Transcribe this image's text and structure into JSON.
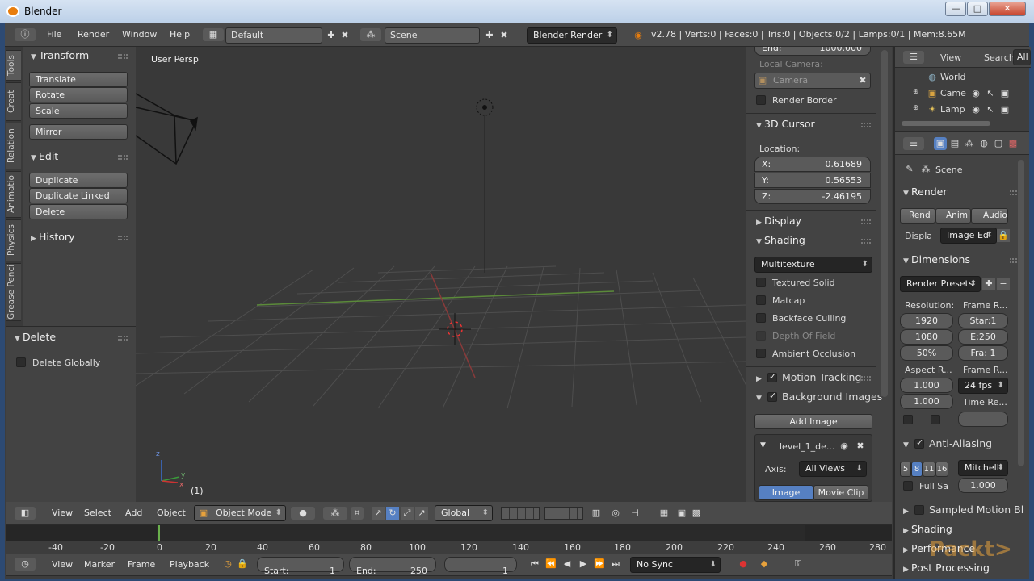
{
  "window": {
    "title": "Blender",
    "min": "—",
    "max": "□",
    "close": "✕"
  },
  "topbar": {
    "menu": [
      "File",
      "Render",
      "Window",
      "Help"
    ],
    "layout": "Default",
    "scene": "Scene",
    "engine": "Blender Render",
    "stats": "v2.78 | Verts:0 | Faces:0 | Tris:0 | Objects:0/2 | Lamps:0/1 | Mem:8.65M"
  },
  "toolshelf": {
    "tabs": [
      "Tools",
      "Creat",
      "Relation",
      "Animatio",
      "Physics",
      "Grease Penci"
    ],
    "transform": {
      "title": "Transform",
      "buttons": [
        "Translate",
        "Rotate",
        "Scale"
      ],
      "mirror": "Mirror"
    },
    "edit": {
      "title": "Edit",
      "buttons": [
        "Duplicate",
        "Duplicate Linked",
        "Delete"
      ]
    },
    "history": {
      "title": "History"
    },
    "operator": {
      "title": "Delete",
      "checkbox": "Delete Globally"
    }
  },
  "viewport": {
    "label": "User Persp",
    "frame": "(1)",
    "axes": {
      "z": "z",
      "y": "y",
      "x": "x"
    }
  },
  "props": {
    "end_label": "End:",
    "end_value": "1000.000",
    "local_camera": "Local Camera:",
    "camera": "Camera",
    "render_border": "Render Border",
    "cursor": {
      "title": "3D Cursor",
      "location": "Location:",
      "x_label": "X:",
      "x": "0.61689",
      "y_label": "Y:",
      "y": "0.56553",
      "z_label": "Z:",
      "z": "-2.46195"
    },
    "display": "Display",
    "shading": "Shading",
    "shading_mode": "Multitexture",
    "shading_opts": [
      {
        "label": "Textured Solid",
        "dim": false
      },
      {
        "label": "Matcap",
        "dim": false
      },
      {
        "label": "Backface Culling",
        "dim": false
      },
      {
        "label": "Depth Of Field",
        "dim": true
      },
      {
        "label": "Ambient Occlusion",
        "dim": false
      }
    ],
    "motion_tracking": "Motion Tracking",
    "bg_images": "Background Images",
    "add_image": "Add Image",
    "bg_item": "level_1_de...",
    "axis_label": "Axis:",
    "axis_value": "All Views",
    "tab_image": "Image",
    "tab_clip": "Movie Clip"
  },
  "outliner": {
    "view": "View",
    "search": "Search",
    "all": "All",
    "items": [
      "World",
      "Came",
      "Lamp"
    ]
  },
  "properties": {
    "scene": "Scene",
    "render": "Render",
    "render_btns": [
      "Rend",
      "Anim",
      "Audio"
    ],
    "display_label": "Displa",
    "display_value": "Image Ed",
    "dimensions": "Dimensions",
    "presets": "Render Presets",
    "resolution": "Resolution:",
    "res_x": "1920",
    "res_y": "1080",
    "res_pct": "50%",
    "frame_range": "Frame R...",
    "start": "Star:1",
    "end": "E:250",
    "step": "Fra: 1",
    "aspect": "Aspect R...",
    "asp_x": "1.000",
    "asp_y": "1.000",
    "frame_rate": "Frame R...",
    "fps": "24 fps",
    "time_remap": "Time Re...",
    "anti_aliasing": "Anti-Aliasing",
    "aa_samples": [
      "5",
      "8",
      "11",
      "16"
    ],
    "aa_filter": "Mitchell-",
    "full_sample": "Full Sa",
    "filter_size": "1.000",
    "sampled_motion": "Sampled Motion Bl",
    "shading": "Shading",
    "performance": "Performance",
    "post": "Post Processing"
  },
  "view3d_header": {
    "menu": [
      "View",
      "Select",
      "Add",
      "Object"
    ],
    "mode": "Object Mode",
    "orientation": "Global"
  },
  "timeline": {
    "ticks": [
      "-40",
      "-20",
      "0",
      "20",
      "40",
      "60",
      "80",
      "100",
      "120",
      "140",
      "160",
      "180",
      "200",
      "220",
      "240",
      "260",
      "280"
    ],
    "menu": [
      "View",
      "Marker",
      "Frame",
      "Playback"
    ],
    "start_label": "Start:",
    "start": "1",
    "end_label": "End:",
    "end": "250",
    "current": "1",
    "sync": "No Sync"
  },
  "watermark": "Packt>"
}
